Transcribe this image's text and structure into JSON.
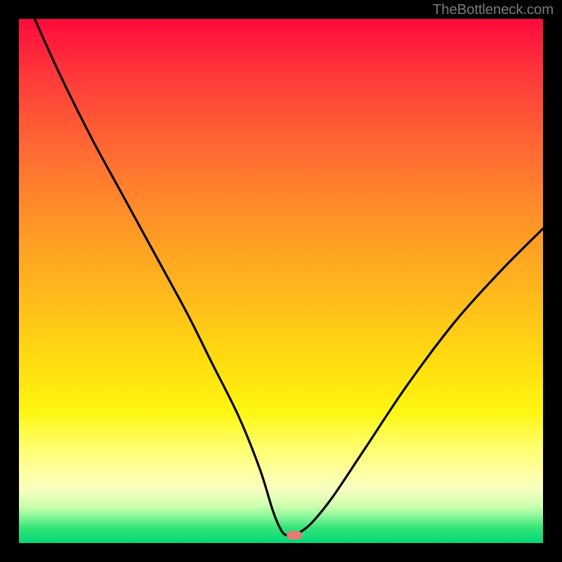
{
  "attribution": "TheBottleneck.com",
  "chart_data": {
    "type": "line",
    "title": "",
    "xlabel": "",
    "ylabel": "",
    "xlim": [
      0,
      100
    ],
    "ylim": [
      0,
      100
    ],
    "series": [
      {
        "name": "bottleneck-curve",
        "x": [
          3,
          8,
          14,
          20,
          26,
          32,
          37,
          42,
          46,
          48.5,
          50,
          51,
          52,
          53.5,
          56,
          60,
          66,
          74,
          83,
          92,
          100
        ],
        "y": [
          100,
          89,
          77,
          66,
          55,
          44,
          34,
          24,
          14,
          6,
          2.5,
          1.5,
          1.5,
          2,
          4,
          9,
          18,
          30,
          42,
          52,
          60
        ]
      }
    ],
    "marker": {
      "x": 52.5,
      "y": 1.5,
      "color": "#e77b75"
    },
    "background_gradient_desc": "vertical red→orange→yellow→green heat gradient"
  }
}
